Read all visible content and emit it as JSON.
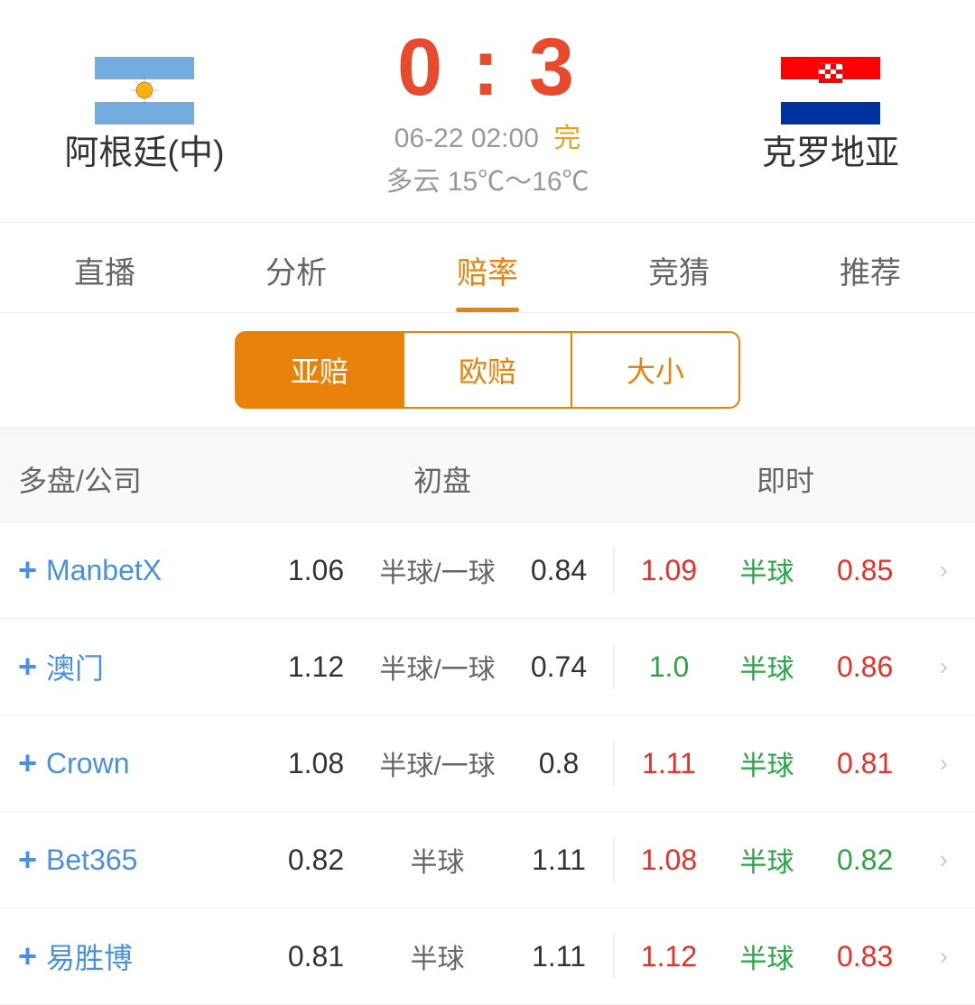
{
  "match": {
    "team_home": "阿根廷(中)",
    "team_away": "克罗地亚",
    "score": "0 : 3",
    "score_left": "0",
    "colon": ":",
    "score_right": "3",
    "date": "06-22 02:00",
    "status": "完",
    "weather": "多云  15℃～16℃"
  },
  "tabs": [
    {
      "label": "直播",
      "active": false
    },
    {
      "label": "分析",
      "active": false
    },
    {
      "label": "赔率",
      "active": true
    },
    {
      "label": "竞猜",
      "active": false
    },
    {
      "label": "推荐",
      "active": false
    }
  ],
  "sub_tabs": [
    {
      "label": "亚赔",
      "active": true
    },
    {
      "label": "欧赔",
      "active": false
    },
    {
      "label": "大小",
      "active": false
    }
  ],
  "table": {
    "col1": "多盘/公司",
    "col2": "初盘",
    "col3": "即时",
    "rows": [
      {
        "company": "ManbetX",
        "init_left": "1.06",
        "init_mid": "半球/一球",
        "init_right": "0.84",
        "live_left": "1.09",
        "live_left_color": "red",
        "live_mid": "半球",
        "live_mid_color": "green",
        "live_right": "0.85",
        "live_right_color": "red"
      },
      {
        "company": "澳门",
        "init_left": "1.12",
        "init_mid": "半球/一球",
        "init_right": "0.74",
        "live_left": "1.0",
        "live_left_color": "green",
        "live_mid": "半球",
        "live_mid_color": "green",
        "live_right": "0.86",
        "live_right_color": "red"
      },
      {
        "company": "Crown",
        "init_left": "1.08",
        "init_mid": "半球/一球",
        "init_right": "0.8",
        "live_left": "1.11",
        "live_left_color": "red",
        "live_mid": "半球",
        "live_mid_color": "green",
        "live_right": "0.81",
        "live_right_color": "red"
      },
      {
        "company": "Bet365",
        "init_left": "0.82",
        "init_mid": "半球",
        "init_right": "1.11",
        "live_left": "1.08",
        "live_left_color": "red",
        "live_mid": "半球",
        "live_mid_color": "green",
        "live_right": "0.82",
        "live_right_color": "green"
      },
      {
        "company": "易胜博",
        "init_left": "0.81",
        "init_mid": "半球",
        "init_right": "1.11",
        "live_left": "1.12",
        "live_left_color": "red",
        "live_mid": "半球",
        "live_mid_color": "green",
        "live_right": "0.83",
        "live_right_color": "red"
      }
    ]
  }
}
